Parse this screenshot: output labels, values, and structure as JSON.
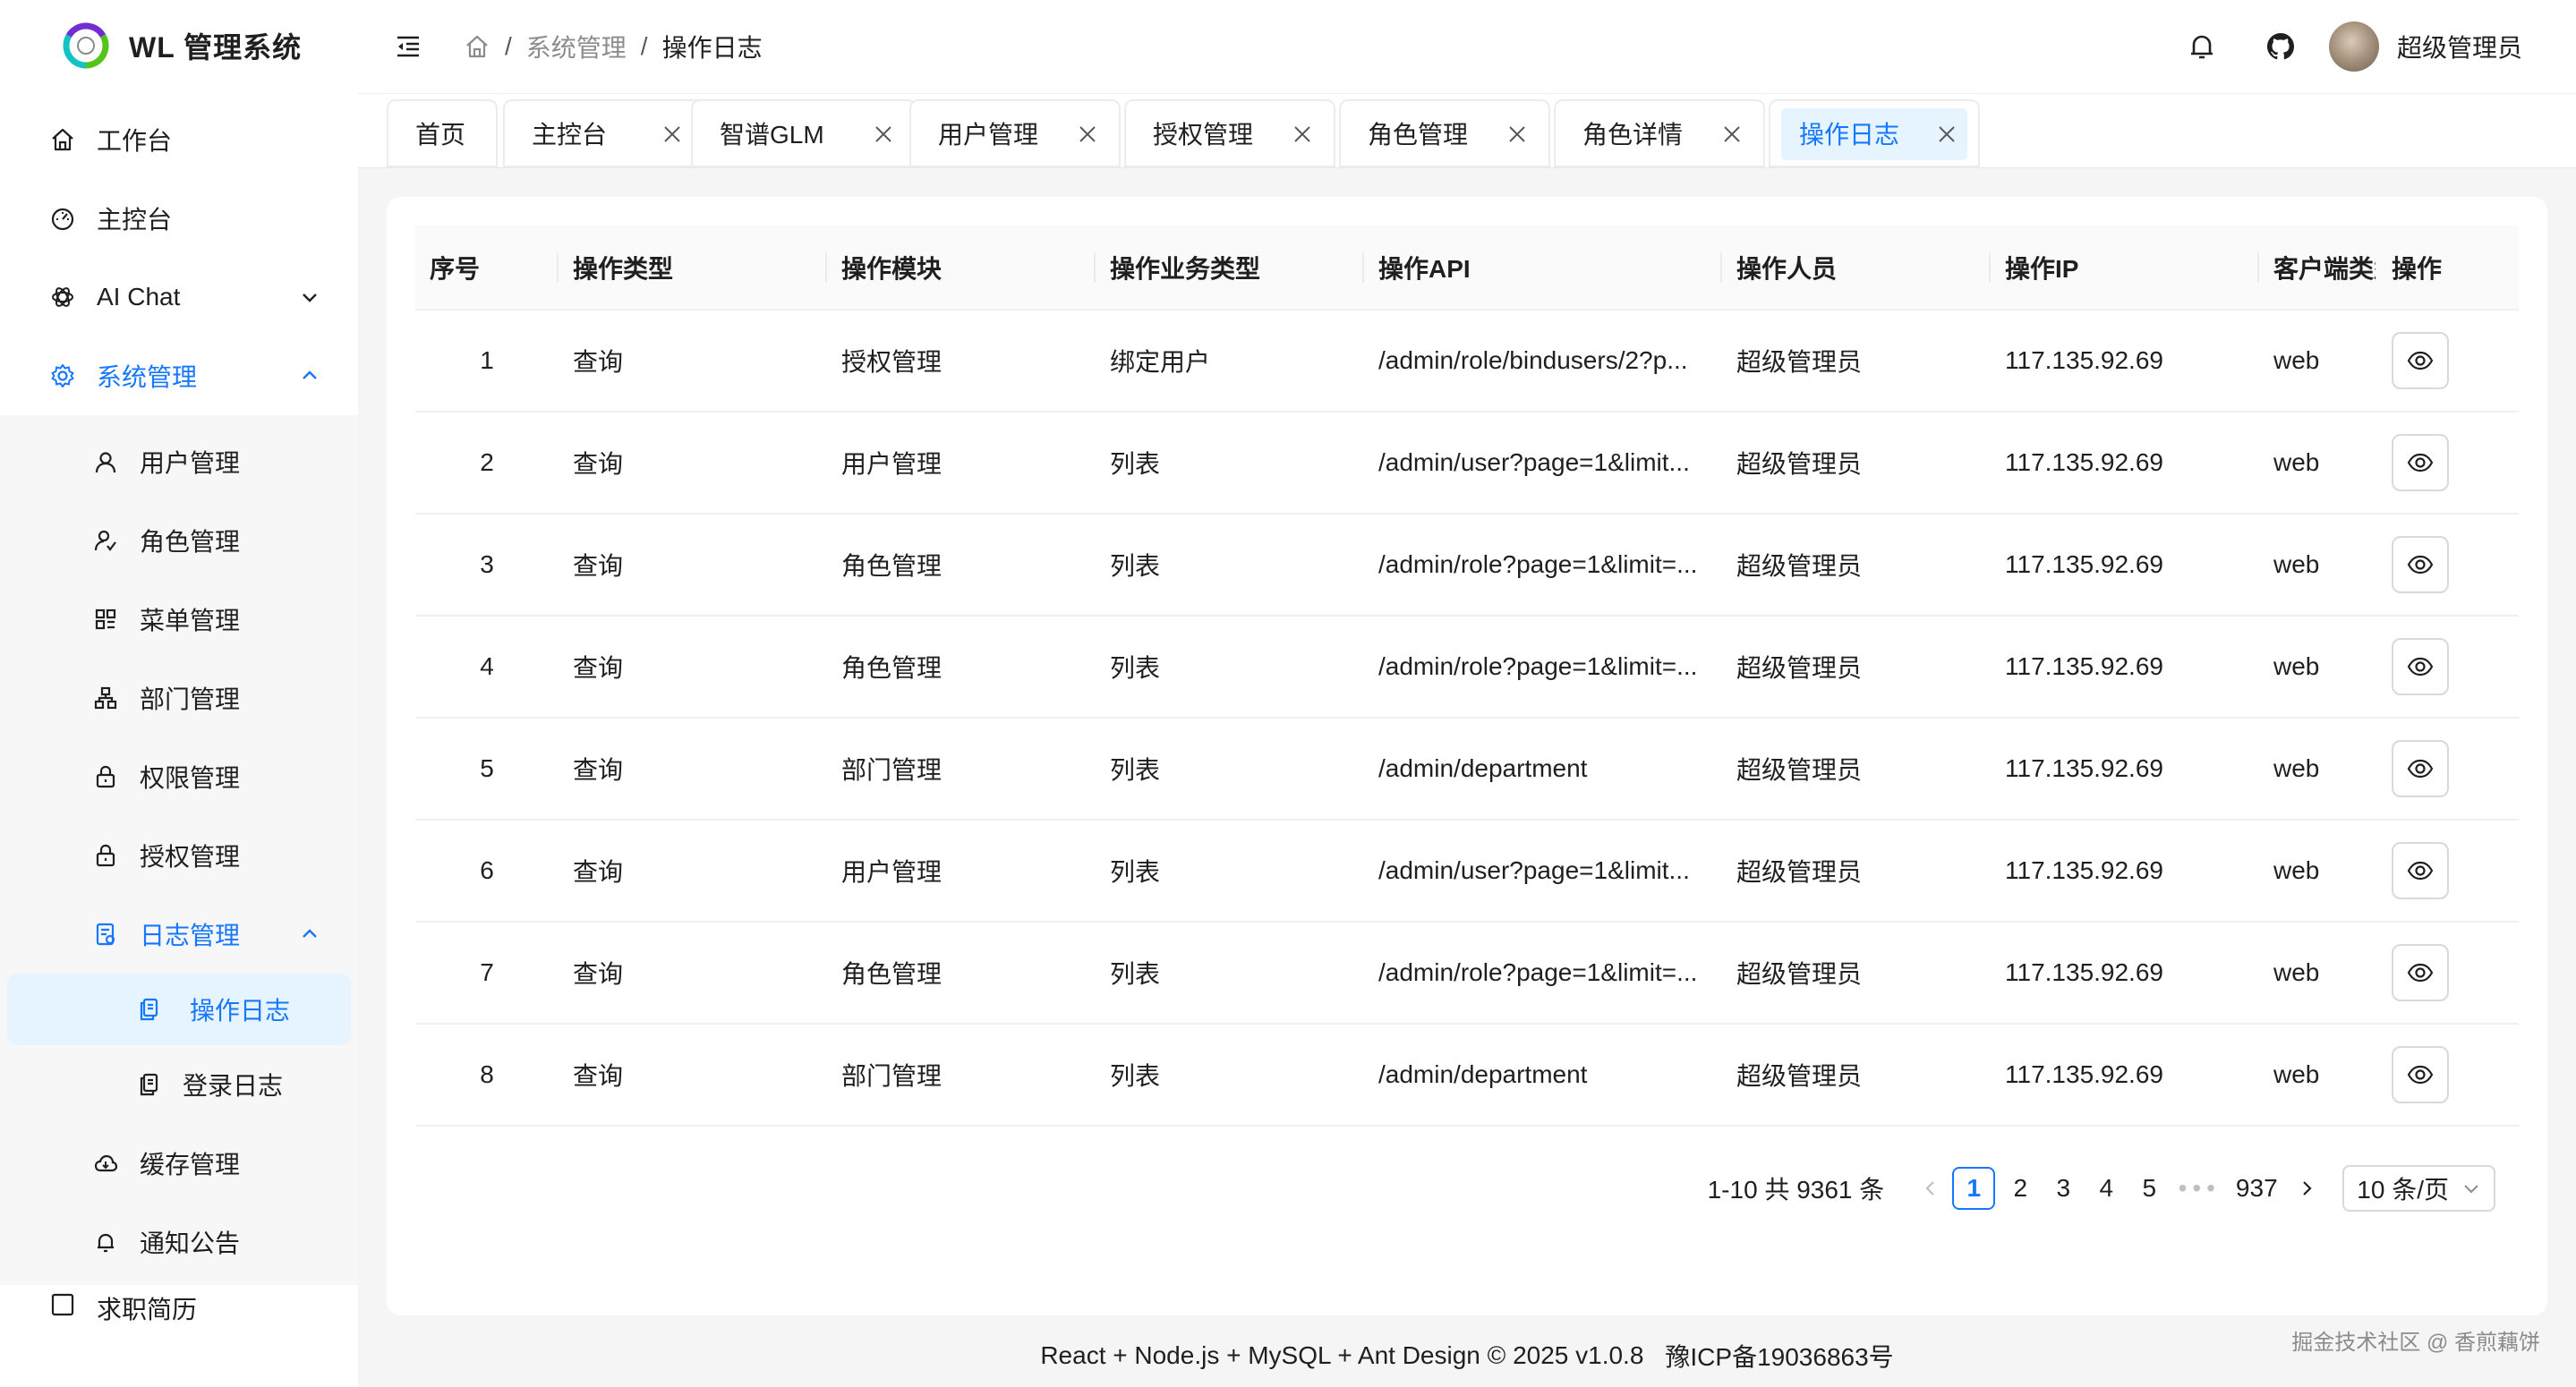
{
  "app": {
    "title": "WL 管理系统"
  },
  "sidebar": {
    "items": [
      {
        "label": "工作台",
        "icon": "home-icon"
      },
      {
        "label": "主控台",
        "icon": "dashboard-icon"
      },
      {
        "label": "AI Chat",
        "icon": "openai-icon"
      },
      {
        "label": "系统管理",
        "icon": "gear-icon"
      }
    ],
    "system_children": [
      {
        "label": "用户管理",
        "icon": "user-icon"
      },
      {
        "label": "角色管理",
        "icon": "user-role-icon"
      },
      {
        "label": "菜单管理",
        "icon": "menu-grid-icon"
      },
      {
        "label": "部门管理",
        "icon": "org-tree-icon"
      },
      {
        "label": "权限管理",
        "icon": "lock-icon"
      },
      {
        "label": "授权管理",
        "icon": "lock-icon"
      },
      {
        "label": "日志管理",
        "icon": "log-icon"
      }
    ],
    "log_children": [
      {
        "label": "操作日志",
        "icon": "copy-doc-icon"
      },
      {
        "label": "登录日志",
        "icon": "copy-doc-icon"
      }
    ],
    "after_items": [
      {
        "label": "缓存管理",
        "icon": "cloud-icon"
      },
      {
        "label": "通知公告",
        "icon": "bell-icon"
      }
    ],
    "partial_item": {
      "label": "求职简历"
    }
  },
  "header": {
    "breadcrumb": [
      "系统管理",
      "操作日志"
    ],
    "breadcrumb_separator": "/",
    "user_name": "超级管理员"
  },
  "tabs": [
    {
      "label": "首页",
      "closable": false
    },
    {
      "label": "主控台",
      "closable": true
    },
    {
      "label": "智谱GLM",
      "closable": true
    },
    {
      "label": "用户管理",
      "closable": true
    },
    {
      "label": "授权管理",
      "closable": true
    },
    {
      "label": "角色管理",
      "closable": true
    },
    {
      "label": "角色详情",
      "closable": true
    },
    {
      "label": "操作日志",
      "closable": true,
      "active": true
    }
  ],
  "table": {
    "columns": [
      "序号",
      "操作类型",
      "操作模块",
      "操作业务类型",
      "操作API",
      "操作人员",
      "操作IP",
      "客户端类型",
      "操作"
    ],
    "rows": [
      {
        "index": "1",
        "type": "查询",
        "module": "授权管理",
        "biz": "绑定用户",
        "api": "/admin/role/bindusers/2?p...",
        "operator": "超级管理员",
        "ip": "117.135.92.69",
        "client": "web"
      },
      {
        "index": "2",
        "type": "查询",
        "module": "用户管理",
        "biz": "列表",
        "api": "/admin/user?page=1&limit...",
        "operator": "超级管理员",
        "ip": "117.135.92.69",
        "client": "web"
      },
      {
        "index": "3",
        "type": "查询",
        "module": "角色管理",
        "biz": "列表",
        "api": "/admin/role?page=1&limit=...",
        "operator": "超级管理员",
        "ip": "117.135.92.69",
        "client": "web"
      },
      {
        "index": "4",
        "type": "查询",
        "module": "角色管理",
        "biz": "列表",
        "api": "/admin/role?page=1&limit=...",
        "operator": "超级管理员",
        "ip": "117.135.92.69",
        "client": "web"
      },
      {
        "index": "5",
        "type": "查询",
        "module": "部门管理",
        "biz": "列表",
        "api": "/admin/department",
        "operator": "超级管理员",
        "ip": "117.135.92.69",
        "client": "web"
      },
      {
        "index": "6",
        "type": "查询",
        "module": "用户管理",
        "biz": "列表",
        "api": "/admin/user?page=1&limit...",
        "operator": "超级管理员",
        "ip": "117.135.92.69",
        "client": "web"
      },
      {
        "index": "7",
        "type": "查询",
        "module": "角色管理",
        "biz": "列表",
        "api": "/admin/role?page=1&limit=...",
        "operator": "超级管理员",
        "ip": "117.135.92.69",
        "client": "web"
      },
      {
        "index": "8",
        "type": "查询",
        "module": "部门管理",
        "biz": "列表",
        "api": "/admin/department",
        "operator": "超级管理员",
        "ip": "117.135.92.69",
        "client": "web"
      }
    ]
  },
  "pagination": {
    "total_text": "1-10 共 9361 条",
    "pages": [
      "1",
      "2",
      "3",
      "4",
      "5"
    ],
    "current": "1",
    "ellipsis": "•••",
    "last_page": "937",
    "page_size": "10 条/页"
  },
  "footer": {
    "text": "React + Node.js + MySQL + Ant Design © 2025 v1.0.8",
    "icp": "豫ICP备19036863号"
  },
  "watermark": "掘金技术社区 @ 香煎藕饼",
  "colors": {
    "accent": "#1677ff",
    "accent_bg": "#e6f4ff",
    "background": "#f5f5f5"
  }
}
